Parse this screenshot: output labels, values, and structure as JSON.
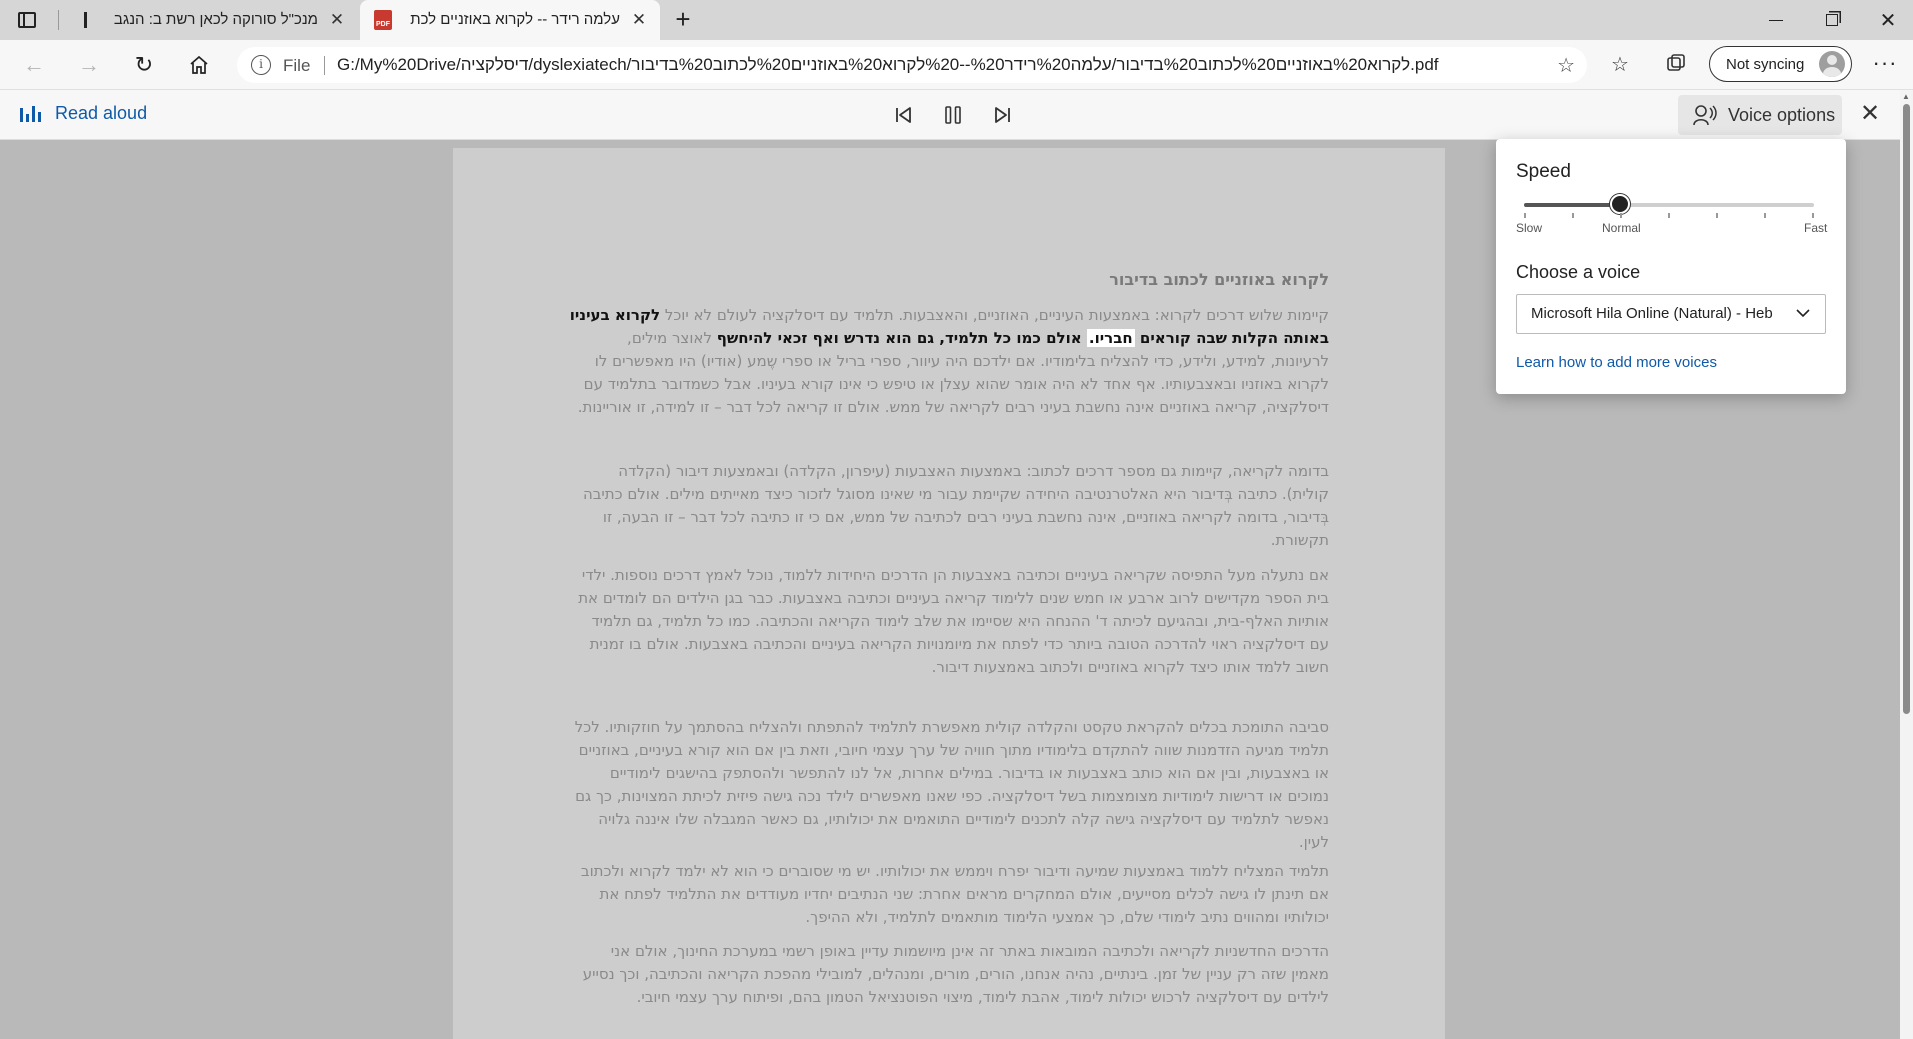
{
  "tabs": [
    {
      "title": "מנכ\"ל סורוקה לכאן רשת ב: הנגב",
      "active": false
    },
    {
      "title": "עלמה רידר -- לקרוא באוזניים לכת",
      "active": true
    }
  ],
  "address": {
    "scheme": "File",
    "url": "G:/My%20Drive/דיסלקציה/dyslexiatech/לקרוא%20באוזניים%20לכתוב%20בדיבור/עלמה%20רידר%20--%20לקרוא%20באוזניים%20לכתוב%20בדיבור.pdf"
  },
  "profile": {
    "sync_label": "Not syncing"
  },
  "read_aloud": {
    "label": "Read aloud",
    "voice_options_label": "Voice options"
  },
  "voice_panel": {
    "speed_label": "Speed",
    "speed_value": 0.33,
    "slow_label": "Slow",
    "normal_label": "Normal",
    "fast_label": "Fast",
    "choose_voice_label": "Choose a voice",
    "selected_voice": "Microsoft Hila Online (Natural) - Heb",
    "learn_more_link": "Learn how to add more voices"
  },
  "document": {
    "heading": "לקרוא באוזניים לכתוב בדיבור",
    "p1_before": "קיימות שלוש דרכים לקרוא: באמצעות העיניים, האוזניים, והאצבעות. תלמיד עם דיסלקציה לעולם לא יוכל",
    "p1_highlight_a": "לקרוא בעיניו באותה הקלות שבה קוראים",
    "p1_current_word": "חבריו.",
    "p1_highlight_b": "אולם כמו כל תלמיד, גם הוא נדרש ואף זכאי להיחשף",
    "p1_after": "לאוצר מילים, לרעיונות, למידע, ולידע, כדי להצליח בלימודיו. אם ילדכם היה עיוור, ספרי בריל או ספרי שֶמע (אודיו) היו מאפשרים לו לקרוא באוזניו ובאצבעותיו. אף אחד לא היה אומר שהוא עצלן או טיפש כי אינו קורא בעיניו. אבל כשמדובר בתלמיד עם דיסלקציה, קריאה באוזניים אינה נחשבת בעיני רבים לקריאה של ממש. אולם זו קריאה לכל דבר – זו למידה, זו אוריינות.",
    "p2": "בדומה לקריאה, קיימות גם מספר דרכים לכתוב: באמצעות האצבעות (עיפרון, הקלדה) ובאמצעות דיבור (הקלדה קולית). כתיבה בְּדיבור היא האלטרנטיבה היחידה שקיימת עבור מי שאינו מסוגל לזכור כיצד מאייתים מילים. אולם כתיבה בְּדיבור, בדומה לקריאה באוזניים, אינה נחשבת בעיני רבים לכתיבה של ממש, אם כי זו כתיבה לכל דבר – זו הבעה, זו תקשורת.",
    "p3": "אם נתעלה מעל התפיסה שקריאה בעיניים וכתיבה באצבעות הן הדרכים היחידות ללמוד, נוכל לאמץ דרכים נוספות. ילדי בית הספר מקדישים לרוב ארבע או חמש שנים ללימוד קריאה בעיניים וכתיבה באצבעות. כבר בגן הילדים הם לומדים את אותיות האלף-בית, ובהגיעם לכיתה ד' ההנחה היא שסיימו את שלב לימוד הקריאה והכתיבה. כמו כל תלמיד, גם תלמיד עם דיסלקציה ראוי להדרכה הטובה ביותר כדי לפתח את מיומנויות הקריאה בעיניים והכתיבה באצבעות. אולם בו זמנית חשוב ללמד אותו כיצד לקרוא באוזניים ולכתוב באמצעות דיבור.",
    "p4": "סביבה התומכת בכלים להקראת טקסט והקלדה קולית מאפשרת לתלמיד להתפתח ולהצליח בהסתמך על חוזקותיו. לכל תלמיד מגיעה הזדמנות שווה להתקדם בלימודיו מתוך חוויה של ערך עצמי חיובי, וזאת בין אם הוא קורא בעיניים, באוזניים או באצבעות, ובין אם הוא כותב באצבעות או בדיבור. במילים אחרות, אל לנו להתפשר ולהסתפק בהישגים לימודיים נמוכים או דרישות לימודיות מצומצמות בשל דיסלקציה. כפי שאנו מאפשרים לילד נכה גישה פיזית לכיתת המצוינות, כך גם נאפשר לתלמיד עם דיסלקציה גישה קלה לתכנים לימודיים התואמים את יכולותיו, גם כאשר המגבלה שלו איננה גלויה לעין.",
    "p5": "תלמיד המצליח ללמוד באמצעות שמיעה ודיבור יפרח ויממש את יכולותיו. יש מי שסוברים כי הוא לא ילמד לקרוא ולכתוב אם תינתן לו גישה לכלים מסייעים, אולם המחקרים מראים אחרת: שני הנתיבים יחדיו מעודדים את התלמיד לפתח את יכולותיו ומהווים נתיב לימודי שלם, כך אמצעי הלימוד מותאמים לתלמיד, ולא ההיפך.",
    "p6": "הדרכים החדשניות לקריאה ולכתיבה המובאות באתר זה אינן מיושמות עדיין באופן רשמי במערכת החינוך, אולם אני מאמין שזה רק עניין של זמן. בינתיים, נהיה אנחנו, הורים, מורים, ומנהלים, למובילי מהפכת הקריאה והכתיבה, וכך נסייע לילדים עם דיסלקציה לרכוש יכולות לימוד, אהבת לימוד, מיצוי הפוטנציאל הטמון בהם, ופיתוח ערך עצמי חיובי."
  }
}
